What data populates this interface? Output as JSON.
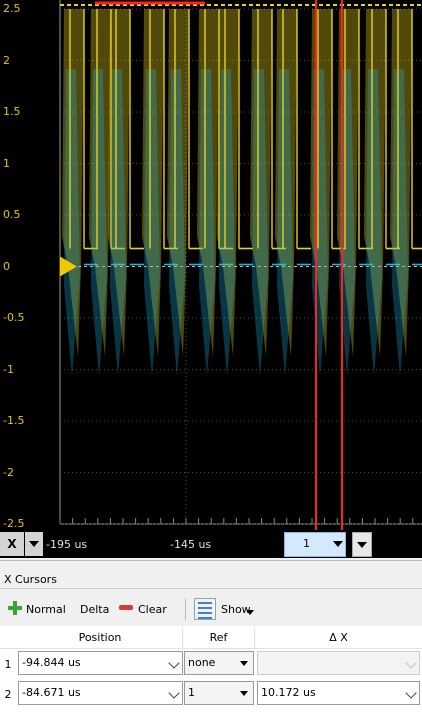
{
  "plot": {
    "y_ticks": [
      "2.5",
      "2",
      "1.5",
      "1",
      "0.5",
      "0",
      "-0.5",
      "-1",
      "-1.5",
      "-2",
      "-2.5"
    ],
    "colors": {
      "channel1": "#e8d21e",
      "channel2": "#1eb4e6",
      "cursor": "#ff2020",
      "axis_text": "#e8c400",
      "background": "#000000"
    }
  },
  "x_axis": {
    "label": "X",
    "ticks": [
      "-195 us",
      "-145 us"
    ],
    "cursor_select": "1"
  },
  "panel": {
    "title": "X Cursors",
    "toolbar": {
      "normal_label": "Normal",
      "delta_label": "Delta",
      "clear_label": "Clear",
      "show_label": "Show"
    },
    "columns": [
      "Position",
      "Ref",
      "Δ X"
    ],
    "rows": [
      {
        "index": "1",
        "position": "-94.844 us",
        "ref": "none",
        "delta": ""
      },
      {
        "index": "2",
        "position": "-84.671 us",
        "ref": "1",
        "delta": "10.172 us"
      }
    ]
  }
}
